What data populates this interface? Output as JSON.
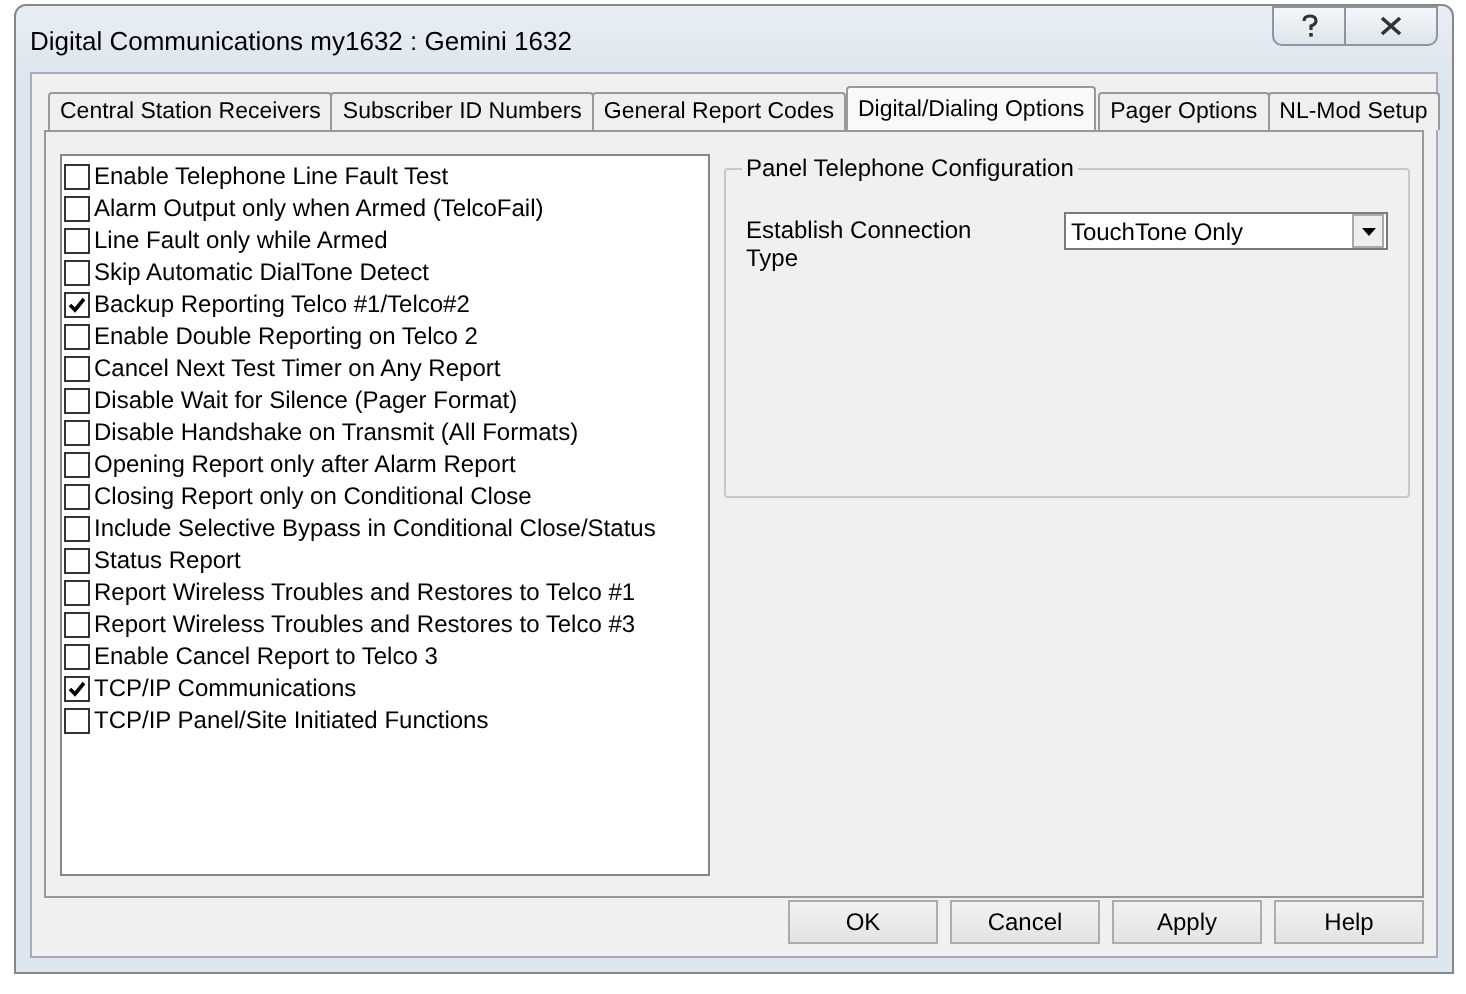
{
  "window": {
    "title": "Digital Communications my1632 : Gemini 1632"
  },
  "tabs": [
    {
      "label": "Central Station Receivers",
      "selected": false
    },
    {
      "label": "Subscriber ID Numbers",
      "selected": false
    },
    {
      "label": "General Report Codes",
      "selected": false
    },
    {
      "label": "Digital/Dialing Options",
      "selected": true
    },
    {
      "label": "Pager Options",
      "selected": false
    },
    {
      "label": "NL-Mod Setup",
      "selected": false
    }
  ],
  "options": [
    {
      "label": "Enable Telephone Line Fault Test",
      "checked": false
    },
    {
      "label": "Alarm Output only when Armed (TelcoFail)",
      "checked": false
    },
    {
      "label": "Line Fault only while Armed",
      "checked": false
    },
    {
      "label": "Skip Automatic DialTone Detect",
      "checked": false
    },
    {
      "label": "Backup Reporting Telco #1/Telco#2",
      "checked": true
    },
    {
      "label": "Enable Double Reporting on Telco 2",
      "checked": false
    },
    {
      "label": "Cancel Next Test Timer on Any Report",
      "checked": false
    },
    {
      "label": "Disable Wait for Silence (Pager Format)",
      "checked": false
    },
    {
      "label": "Disable Handshake on Transmit (All Formats)",
      "checked": false
    },
    {
      "label": "Opening Report only after Alarm Report",
      "checked": false
    },
    {
      "label": "Closing Report only on Conditional Close",
      "checked": false
    },
    {
      "label": "Include Selective Bypass in Conditional Close/Status",
      "checked": false
    },
    {
      "label": "Status Report",
      "checked": false
    },
    {
      "label": "Report Wireless Troubles and Restores to Telco #1",
      "checked": false
    },
    {
      "label": "Report Wireless Troubles and Restores to Telco #3",
      "checked": false
    },
    {
      "label": "Enable Cancel Report to Telco 3",
      "checked": false
    },
    {
      "label": "TCP/IP Communications",
      "checked": true
    },
    {
      "label": "TCP/IP Panel/Site Initiated Functions",
      "checked": false
    }
  ],
  "group": {
    "title": "Panel Telephone Configuration",
    "field_label": "Establish Connection Type",
    "value": "TouchTone Only"
  },
  "buttons": [
    "OK",
    "Cancel",
    "Apply",
    "Help"
  ]
}
